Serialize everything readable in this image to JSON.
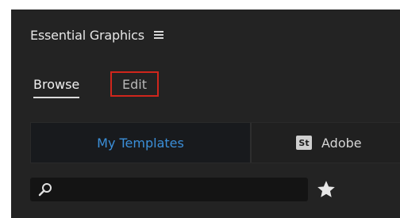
{
  "panel": {
    "title": "Essential Graphics",
    "menu_icon": "hamburger-icon"
  },
  "tabs": {
    "browse_label": "Browse",
    "edit_label": "Edit",
    "active": "Browse"
  },
  "segment": {
    "left_label": "My Templates",
    "right_badge": "St",
    "right_label": "Adobe"
  },
  "search": {
    "placeholder": "",
    "icon": "search-icon"
  },
  "favorites": {
    "icon": "star-icon"
  },
  "colors": {
    "panel_bg": "#232323",
    "accent_blue": "#3b8fd9",
    "highlight_red": "#d0261c"
  }
}
